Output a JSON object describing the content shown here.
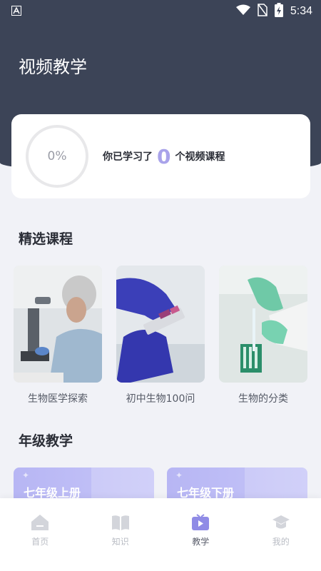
{
  "status_bar": {
    "time": "5:34"
  },
  "page": {
    "title": "视频教学"
  },
  "progress": {
    "percent_label": "0%",
    "prefix": "你已学习了",
    "count": "0",
    "suffix": "个视频课程"
  },
  "featured": {
    "title": "精选课程",
    "courses": [
      {
        "label": "生物医学探索"
      },
      {
        "label": "初中生物100问"
      },
      {
        "label": "生物的分类"
      }
    ]
  },
  "grades": {
    "title": "年级教学",
    "items": [
      {
        "label": "七年级上册"
      },
      {
        "label": "七年级下册"
      }
    ]
  },
  "nav": {
    "items": [
      {
        "label": "首页",
        "icon": "home-icon"
      },
      {
        "label": "知识",
        "icon": "book-icon"
      },
      {
        "label": "教学",
        "icon": "video-icon"
      },
      {
        "label": "我的",
        "icon": "graduation-cap-icon"
      }
    ],
    "active_index": 2
  }
}
